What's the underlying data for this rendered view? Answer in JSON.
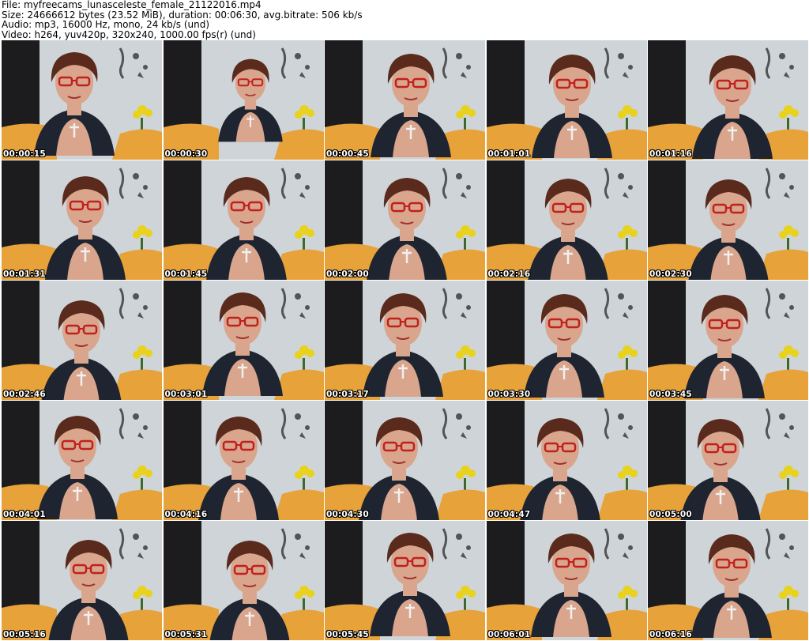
{
  "header": {
    "file_line": "File: myfreecams_lunasceleste_female_21122016.mp4",
    "size_line": "Size: 24666612 bytes (23.52 MiB), duration: 00:06:30, avg.bitrate: 506 kb/s",
    "audio_line": "Audio: mp3, 16000 Hz, mono, 24 kb/s (und)",
    "video_line": "Video: h264, yuv420p, 320x240, 1000.00 fps(r) (und)"
  },
  "thumbnails": [
    {
      "timestamp": "00:00:15"
    },
    {
      "timestamp": "00:00:30"
    },
    {
      "timestamp": "00:00:45"
    },
    {
      "timestamp": "00:01:01"
    },
    {
      "timestamp": "00:01:16"
    },
    {
      "timestamp": "00:01:31"
    },
    {
      "timestamp": "00:01:45"
    },
    {
      "timestamp": "00:02:00"
    },
    {
      "timestamp": "00:02:16"
    },
    {
      "timestamp": "00:02:30"
    },
    {
      "timestamp": "00:02:46"
    },
    {
      "timestamp": "00:03:01"
    },
    {
      "timestamp": "00:03:17"
    },
    {
      "timestamp": "00:03:30"
    },
    {
      "timestamp": "00:03:45"
    },
    {
      "timestamp": "00:04:01"
    },
    {
      "timestamp": "00:04:16"
    },
    {
      "timestamp": "00:04:30"
    },
    {
      "timestamp": "00:04:47"
    },
    {
      "timestamp": "00:05:00"
    },
    {
      "timestamp": "00:05:16"
    },
    {
      "timestamp": "00:05:31"
    },
    {
      "timestamp": "00:05:45"
    },
    {
      "timestamp": "00:06:01"
    },
    {
      "timestamp": "00:06:16"
    }
  ],
  "colors": {
    "wall": "#cfd4d8",
    "door": "#1c1c1e",
    "blanket": "#e8a23a",
    "hair": "#5a2a1c",
    "skin": "#d9a58c",
    "vest": "#1e2430",
    "glasses": "#c0201e",
    "flowers": "#e8d21c"
  }
}
